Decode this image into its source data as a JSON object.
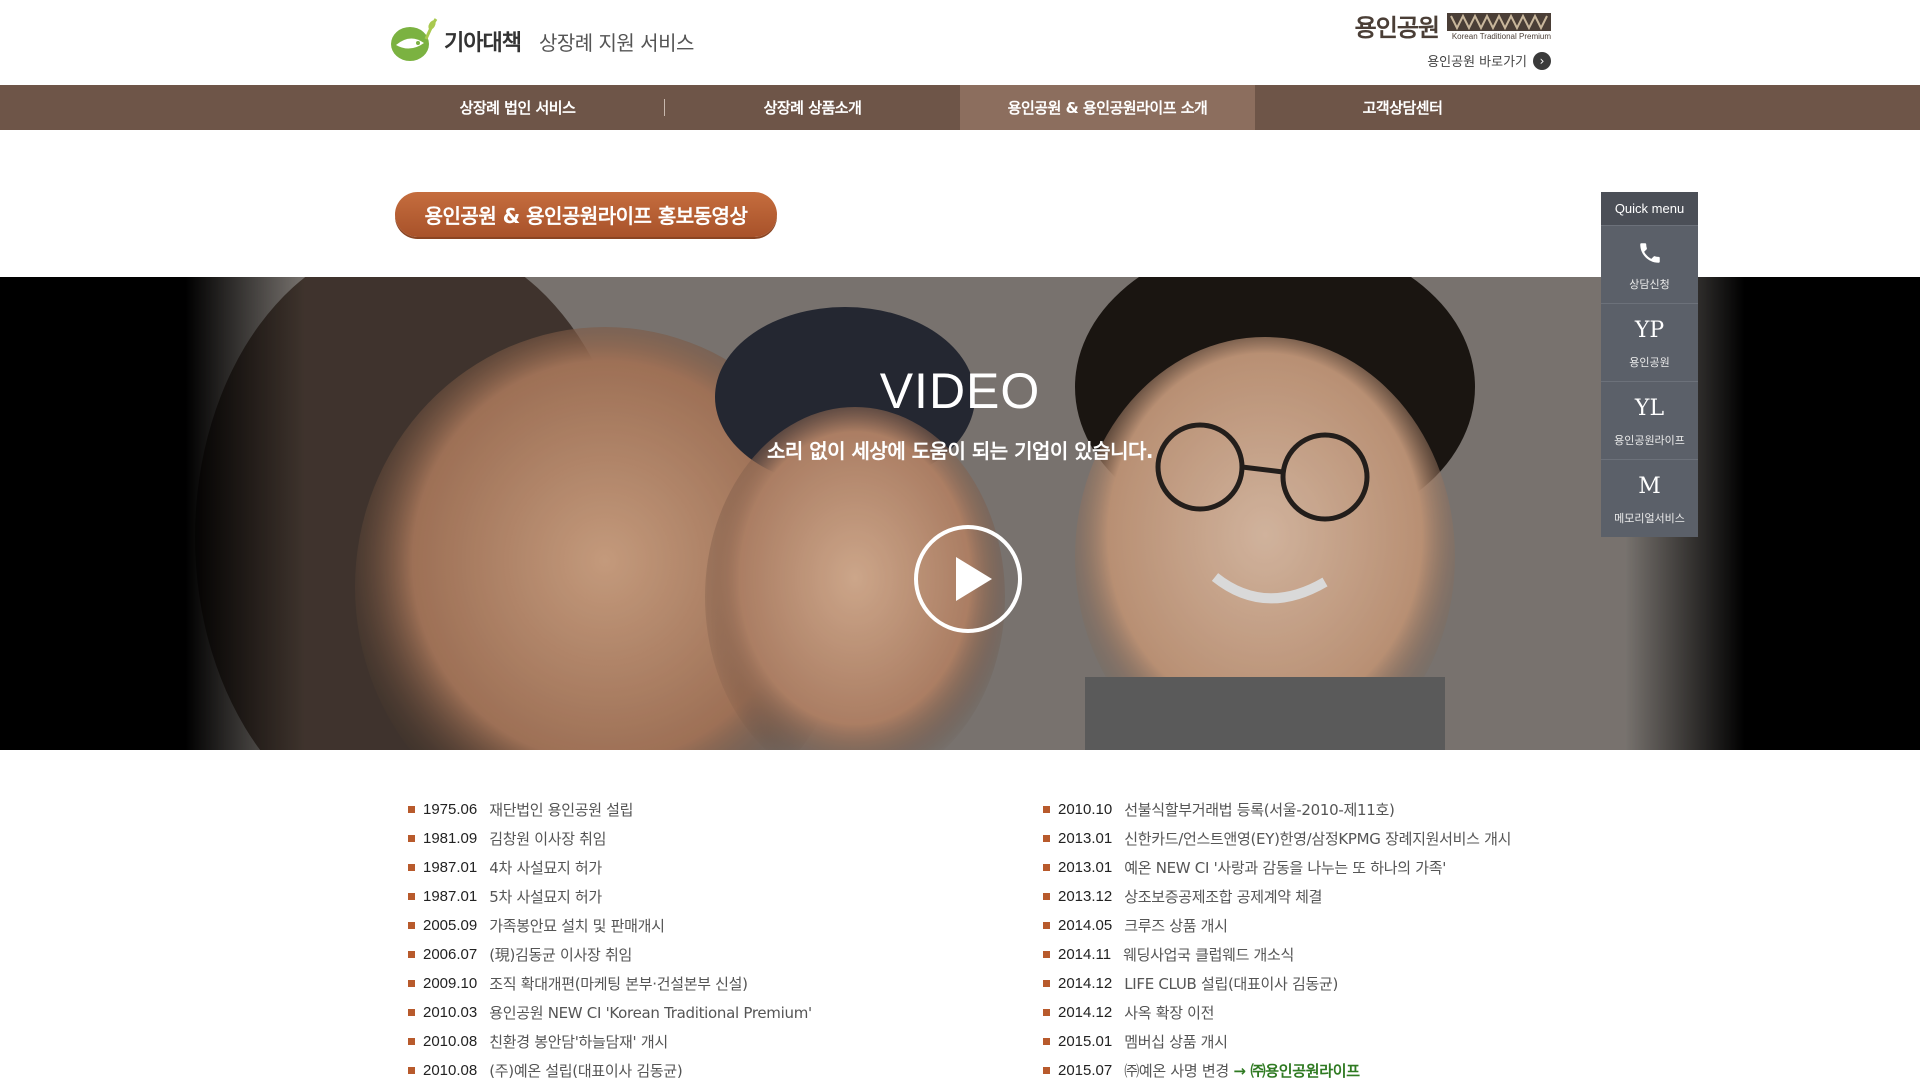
{
  "header": {
    "brand_name": "기아대책",
    "service_title": "상장례 지원 서비스",
    "partner": {
      "title": "용인공원",
      "tagline": "Korean Traditional Premium",
      "link_label": "용인공원 바로가기",
      "link_icon": "chevron-right-icon"
    }
  },
  "nav": {
    "items": [
      {
        "label": "상장례 법인 서비스"
      },
      {
        "label": "상장례 상품소개"
      },
      {
        "label": "용인공원 & 용인공원라이프 소개"
      },
      {
        "label": "고객상담센터"
      }
    ],
    "active_index": 2
  },
  "section": {
    "title": "용인공원 & 용인공원라이프 홍보동영상"
  },
  "quick_menu": {
    "title": "Quick menu",
    "items": [
      {
        "icon": "phone-icon",
        "glyph": "",
        "label": "상담신청"
      },
      {
        "icon": "yp-icon",
        "glyph": "YP",
        "label": "용인공원"
      },
      {
        "icon": "yl-icon",
        "glyph": "YL",
        "label": "용인공원라이프"
      },
      {
        "icon": "m-icon",
        "glyph": "M",
        "label": "메모리얼서비스"
      }
    ]
  },
  "video": {
    "heading": "VIDEO",
    "subheading": "소리 없이 세상에 도움이 되는 기업이 있습니다.",
    "play_icon": "play-icon"
  },
  "history": {
    "left": [
      {
        "date": "1975.06",
        "text": "재단법인 용인공원 설립"
      },
      {
        "date": "1981.09",
        "text": "김창원 이사장 취임"
      },
      {
        "date": "1987.01",
        "text": "4차 사설묘지 허가"
      },
      {
        "date": "1987.01",
        "text": "5차 사설묘지 허가"
      },
      {
        "date": "2005.09",
        "text": "가족봉안묘 설치 및 판매개시"
      },
      {
        "date": "2006.07",
        "text": "(現)김동균 이사장 취임"
      },
      {
        "date": "2009.10",
        "text": "조직 확대개편(마케팅 본부·건설본부 신설)"
      },
      {
        "date": "2010.03",
        "text": "용인공원 NEW CI 'Korean Traditional Premium'"
      },
      {
        "date": "2010.08",
        "text": "친환경 봉안담'하늘담재' 개시"
      },
      {
        "date": "2010.08",
        "text": "(주)예온 설립(대표이사 김동균)"
      }
    ],
    "right": [
      {
        "date": "2010.10",
        "text": "선불식할부거래법 등록(서울-2010-제11호)"
      },
      {
        "date": "2013.01",
        "text": "신한카드/언스트앤영(EY)한영/삼정KPMG 장례지원서비스 개시"
      },
      {
        "date": "2013.01",
        "text": "예온 NEW CI '사랑과 감동을 나누는 또 하나의 가족'"
      },
      {
        "date": "2013.12",
        "text": "상조보증공제조합 공제계약 체결"
      },
      {
        "date": "2014.05",
        "text": "크루즈 상품 개시"
      },
      {
        "date": "2014.11",
        "text": "웨딩사업국 클럽웨드 개소식"
      },
      {
        "date": "2014.12",
        "text": "LIFE CLUB 설립(대표이사 김동균)"
      },
      {
        "date": "2014.12",
        "text": "사옥 확장 이전"
      },
      {
        "date": "2015.01",
        "text": "멤버십 상품 개시"
      },
      {
        "date": "2015.07",
        "text": "㈜예온 사명 변경",
        "highlight": "→ ㈜용인공원라이프"
      }
    ]
  },
  "colors": {
    "nav_bg": "#6e5548",
    "nav_active": "#8c6e5e",
    "accent": "#b85a2c",
    "quick_bg": "#5b6069",
    "highlight_green": "#2f7a22"
  }
}
